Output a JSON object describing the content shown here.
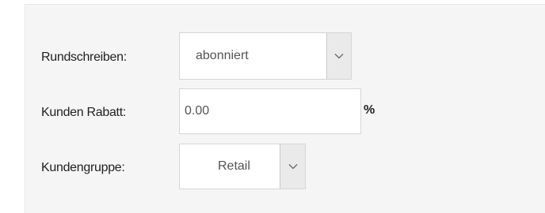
{
  "form": {
    "newsletter": {
      "label": "Rundschreiben:",
      "value": "abonniert",
      "icon": "chevron-down-icon"
    },
    "discount": {
      "label": "Kunden Rabatt:",
      "value": "0.00",
      "suffix": "%"
    },
    "customer_group": {
      "label": "Kundengruppe:",
      "value": "Retail",
      "icon": "chevron-down-icon"
    }
  }
}
